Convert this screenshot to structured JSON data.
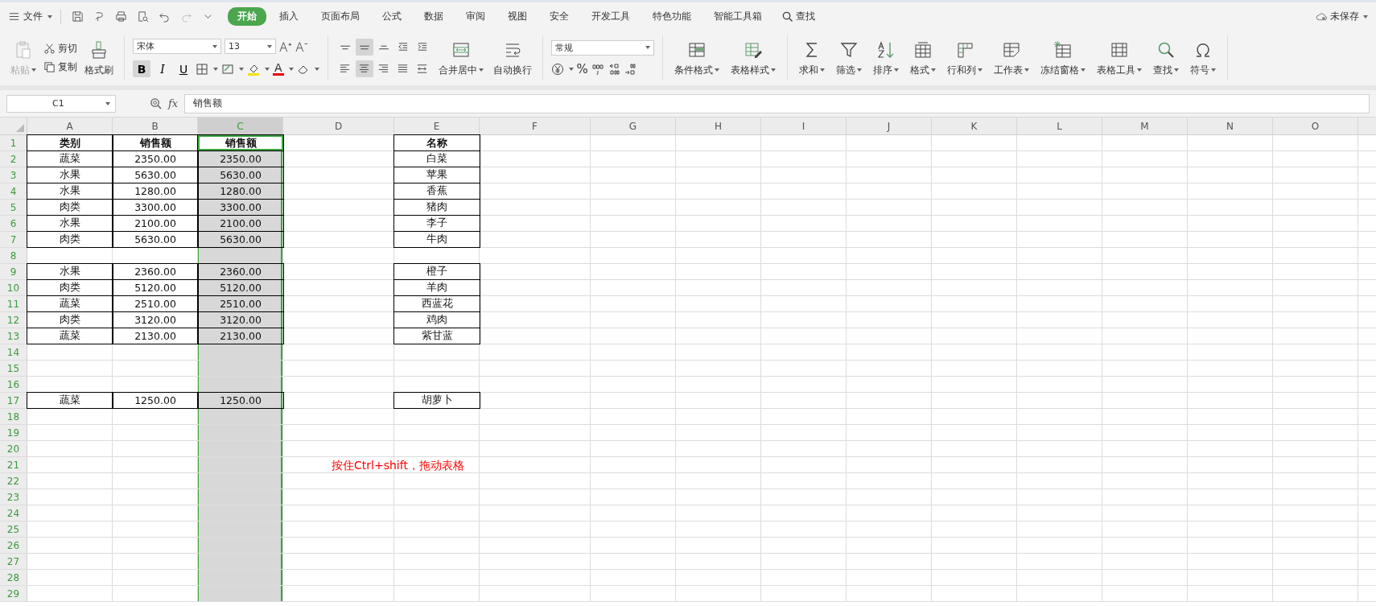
{
  "menu": {
    "file": "文件",
    "tabs": [
      {
        "label": "开始",
        "selected": true
      },
      {
        "label": "插入",
        "selected": false
      },
      {
        "label": "页面布局",
        "selected": false
      },
      {
        "label": "公式",
        "selected": false
      },
      {
        "label": "数据",
        "selected": false
      },
      {
        "label": "审阅",
        "selected": false
      },
      {
        "label": "视图",
        "selected": false
      },
      {
        "label": "安全",
        "selected": false
      },
      {
        "label": "开发工具",
        "selected": false
      },
      {
        "label": "特色功能",
        "selected": false
      },
      {
        "label": "智能工具箱",
        "selected": false
      }
    ],
    "search": "查找",
    "save_status": "未保存"
  },
  "ribbon": {
    "paste": {
      "label": "粘贴",
      "disabled": true
    },
    "cut": "剪切",
    "copy": "复制",
    "format_painter": "格式刷",
    "font": {
      "name": "宋体",
      "size": "13"
    },
    "format_buttons": [
      {
        "text": "B",
        "selected": true
      },
      {
        "text": "I",
        "selected": false
      },
      {
        "text": "U",
        "selected": false
      }
    ],
    "font_color": "A",
    "align_buttons": [
      {
        "kind": "top",
        "selected": false
      },
      {
        "kind": "middle",
        "selected": true
      },
      {
        "kind": "bottom",
        "selected": false
      },
      {
        "kind": "outdent",
        "selected": false
      },
      {
        "kind": "indent",
        "selected": false
      },
      {
        "kind": "left",
        "selected": false
      },
      {
        "kind": "center",
        "selected": true
      },
      {
        "kind": "right",
        "selected": false
      },
      {
        "kind": "justify",
        "selected": false
      },
      {
        "kind": "distribute",
        "selected": false
      }
    ],
    "merge": "合并居中",
    "wrap": "自动换行",
    "number_format": "常规",
    "percent": "%",
    "tools": [
      {
        "label": "条件格式",
        "kind": "conditional"
      },
      {
        "label": "表格样式",
        "kind": "style"
      },
      {
        "label": "求和",
        "kind": "sum"
      },
      {
        "label": "筛选",
        "kind": "filter"
      },
      {
        "label": "排序",
        "kind": "sort"
      },
      {
        "label": "格式",
        "kind": "format"
      },
      {
        "label": "行和列",
        "kind": "rowcol"
      },
      {
        "label": "工作表",
        "kind": "sheet"
      },
      {
        "label": "冻结窗格",
        "kind": "freeze"
      },
      {
        "label": "表格工具",
        "kind": "tabletool"
      },
      {
        "label": "查找",
        "kind": "find"
      },
      {
        "label": "符号",
        "kind": "symbol"
      }
    ]
  },
  "formula_bar": {
    "name_box": "C1",
    "fx": "fx",
    "value": "销售额"
  },
  "columns": [
    {
      "label": "A",
      "selected": false
    },
    {
      "label": "B",
      "selected": false
    },
    {
      "label": "C",
      "selected": true
    },
    {
      "label": "D",
      "selected": false
    },
    {
      "label": "E",
      "selected": false
    },
    {
      "label": "F",
      "selected": false
    },
    {
      "label": "G",
      "selected": false
    },
    {
      "label": "H",
      "selected": false
    },
    {
      "label": "I",
      "selected": false
    },
    {
      "label": "J",
      "selected": false
    },
    {
      "label": "K",
      "selected": false
    },
    {
      "label": "L",
      "selected": false
    },
    {
      "label": "M",
      "selected": false
    },
    {
      "label": "N",
      "selected": false
    },
    {
      "label": "O",
      "selected": false
    }
  ],
  "rows": [
    {
      "label": "1",
      "cells": [
        {
          "text": "类别",
          "kind": "heading",
          "active": false
        },
        {
          "text": "销售额",
          "kind": "heading",
          "active": false
        },
        {
          "text": "销售额",
          "kind": "heading",
          "active": true
        },
        null,
        {
          "text": "名称",
          "kind": "heading",
          "active": false
        }
      ]
    },
    {
      "label": "2",
      "cells": [
        {
          "text": "蔬菜",
          "kind": "value"
        },
        {
          "text": "2350.00",
          "kind": "value"
        },
        {
          "text": "2350.00",
          "kind": "value"
        },
        null,
        {
          "text": "白菜",
          "kind": "value"
        }
      ]
    },
    {
      "label": "3",
      "cells": [
        {
          "text": "水果",
          "kind": "value"
        },
        {
          "text": "5630.00",
          "kind": "value"
        },
        {
          "text": "5630.00",
          "kind": "value"
        },
        null,
        {
          "text": "苹果",
          "kind": "value"
        }
      ]
    },
    {
      "label": "4",
      "cells": [
        {
          "text": "水果",
          "kind": "value"
        },
        {
          "text": "1280.00",
          "kind": "value"
        },
        {
          "text": "1280.00",
          "kind": "value"
        },
        null,
        {
          "text": "香蕉",
          "kind": "value"
        }
      ]
    },
    {
      "label": "5",
      "cells": [
        {
          "text": "肉类",
          "kind": "value"
        },
        {
          "text": "3300.00",
          "kind": "value"
        },
        {
          "text": "3300.00",
          "kind": "value"
        },
        null,
        {
          "text": "猪肉",
          "kind": "value"
        }
      ]
    },
    {
      "label": "6",
      "cells": [
        {
          "text": "水果",
          "kind": "value"
        },
        {
          "text": "2100.00",
          "kind": "value"
        },
        {
          "text": "2100.00",
          "kind": "value"
        },
        null,
        {
          "text": "李子",
          "kind": "value"
        }
      ]
    },
    {
      "label": "7",
      "cells": [
        {
          "text": "肉类",
          "kind": "value"
        },
        {
          "text": "5630.00",
          "kind": "value"
        },
        {
          "text": "5630.00",
          "kind": "value"
        },
        null,
        {
          "text": "牛肉",
          "kind": "value"
        }
      ]
    },
    {
      "label": "8"
    },
    {
      "label": "9",
      "cells": [
        {
          "text": "水果",
          "kind": "value"
        },
        {
          "text": "2360.00",
          "kind": "value"
        },
        {
          "text": "2360.00",
          "kind": "value"
        },
        null,
        {
          "text": "橙子",
          "kind": "value"
        }
      ]
    },
    {
      "label": "10",
      "cells": [
        {
          "text": "肉类",
          "kind": "value"
        },
        {
          "text": "5120.00",
          "kind": "value"
        },
        {
          "text": "5120.00",
          "kind": "value"
        },
        null,
        {
          "text": "羊肉",
          "kind": "value"
        }
      ]
    },
    {
      "label": "11",
      "cells": [
        {
          "text": "蔬菜",
          "kind": "value"
        },
        {
          "text": "2510.00",
          "kind": "value"
        },
        {
          "text": "2510.00",
          "kind": "value"
        },
        null,
        {
          "text": "西蓝花",
          "kind": "value"
        }
      ]
    },
    {
      "label": "12",
      "cells": [
        {
          "text": "肉类",
          "kind": "value"
        },
        {
          "text": "3120.00",
          "kind": "value"
        },
        {
          "text": "3120.00",
          "kind": "value"
        },
        null,
        {
          "text": "鸡肉",
          "kind": "value"
        }
      ]
    },
    {
      "label": "13",
      "cells": [
        {
          "text": "蔬菜",
          "kind": "value"
        },
        {
          "text": "2130.00",
          "kind": "value"
        },
        {
          "text": "2130.00",
          "kind": "value"
        },
        null,
        {
          "text": "紫甘蓝",
          "kind": "value"
        }
      ]
    },
    {
      "label": "14"
    },
    {
      "label": "15"
    },
    {
      "label": "16"
    },
    {
      "label": "17",
      "cells": [
        {
          "text": "蔬菜",
          "kind": "value"
        },
        {
          "text": "1250.00",
          "kind": "value"
        },
        {
          "text": "1250.00",
          "kind": "value"
        },
        null,
        {
          "text": "胡萝卜",
          "kind": "value"
        }
      ]
    },
    {
      "label": "18"
    },
    {
      "label": "19"
    },
    {
      "label": "20"
    },
    {
      "label": "21",
      "note": "按住Ctrl+shift，拖动表格"
    },
    {
      "label": "22"
    },
    {
      "label": "23"
    },
    {
      "label": "24"
    },
    {
      "label": "25"
    },
    {
      "label": "26"
    },
    {
      "label": "27"
    },
    {
      "label": "28"
    },
    {
      "label": "29"
    }
  ]
}
